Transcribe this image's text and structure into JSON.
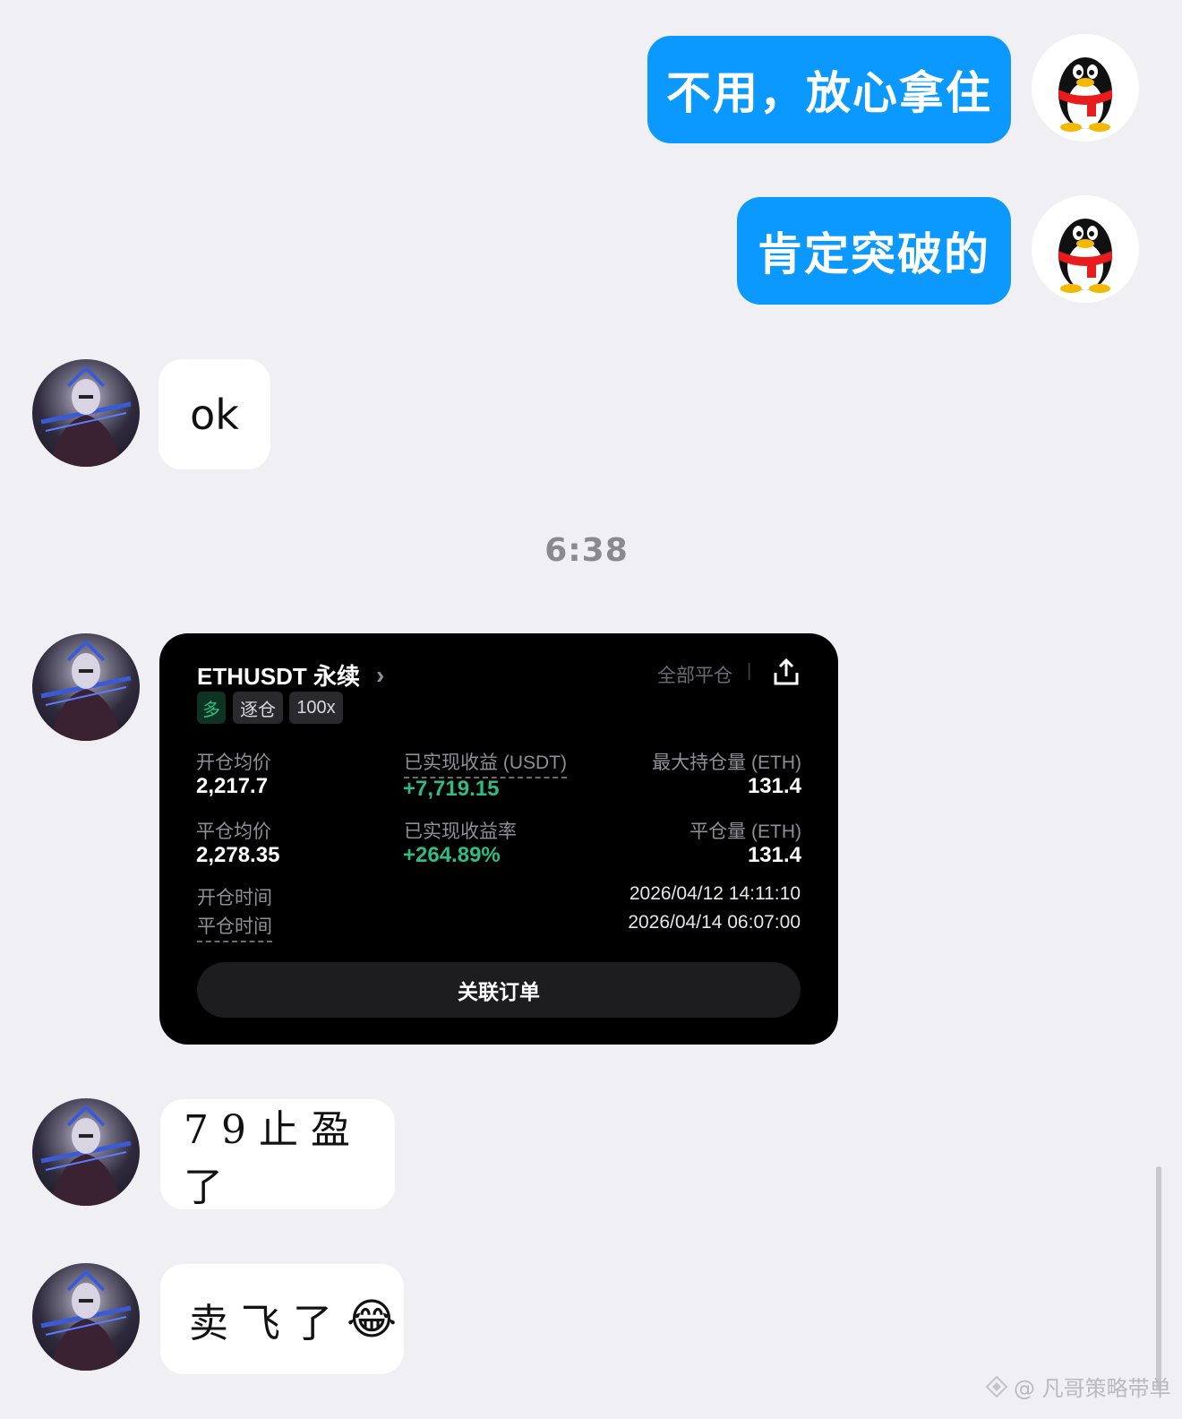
{
  "messages": {
    "out1": "不用，放心拿住",
    "out2": "肯定突破的",
    "in1": "ok",
    "in2": "79止盈了",
    "in3_text": "卖飞了",
    "in3_emoji": "😂"
  },
  "timestamp": "6:38",
  "trade_card": {
    "symbol": "ETHUSDT 永续",
    "chevron": "›",
    "close_all": "全部平仓",
    "divider": "|",
    "tags": {
      "side": "多",
      "margin": "逐仓",
      "leverage": "100x"
    },
    "open_avg_label": "开仓均价",
    "open_avg_value": "2,217.7",
    "realized_pnl_label": "已实现收益 (USDT)",
    "realized_pnl_value": "+7,719.15",
    "max_pos_label": "最大持仓量 (ETH)",
    "max_pos_value": "131.4",
    "close_avg_label": "平仓均价",
    "close_avg_value": "2,278.35",
    "realized_rate_label": "已实现收益率",
    "realized_rate_value": "+264.89%",
    "close_qty_label": "平仓量 (ETH)",
    "close_qty_value": "131.4",
    "open_time_label": "开仓时间",
    "open_time_value": "2026/04/12 14:11:10",
    "close_time_label": "平仓时间",
    "close_time_value": "2026/04/14 06:07:00",
    "linked_orders_button": "关联订单"
  },
  "watermark": "@ 凡哥策略带单",
  "colors": {
    "outgoing_bubble": "#0c99ff",
    "profit_green": "#2ebd85",
    "background": "#efeff4"
  }
}
